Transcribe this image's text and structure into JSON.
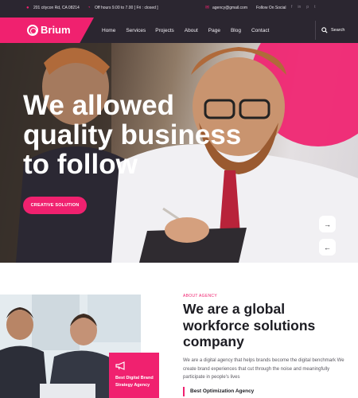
{
  "topbar": {
    "address": "201 citycon Rd, CA 08214",
    "hours": "Off hours 9.00 to 7.00 [ Fri : closed ]",
    "email": "agency@gmail.com",
    "social_label": "Follow On Social",
    "social_icons": [
      "facebook-icon",
      "linkedin-icon",
      "pinterest-icon",
      "twitter-icon"
    ]
  },
  "navbar": {
    "brand": "Brium",
    "items": [
      "Home",
      "Services",
      "Projects",
      "About",
      "Page",
      "Blog",
      "Contact"
    ],
    "search_label": "Search"
  },
  "hero": {
    "title_line1": "We allowed",
    "title_line2": "quality business",
    "title_line3": "to follow",
    "cta": "CREATIVE SOLUTION",
    "next_arrow": "→",
    "prev_arrow": "←"
  },
  "about": {
    "eyebrow": "ABOUT AGENCY",
    "title": "We are a global workforce solutions company",
    "description": "We are a digital agency that helps brands become the digital benchmark We create brand experiences that cut through the noise and meaningfully participate in people's lives",
    "badge_text": "Best Digital Brand Strategy Agency",
    "feature": "Best Optimization Agency"
  },
  "colors": {
    "accent": "#f0216f",
    "dark": "#2b2630"
  }
}
